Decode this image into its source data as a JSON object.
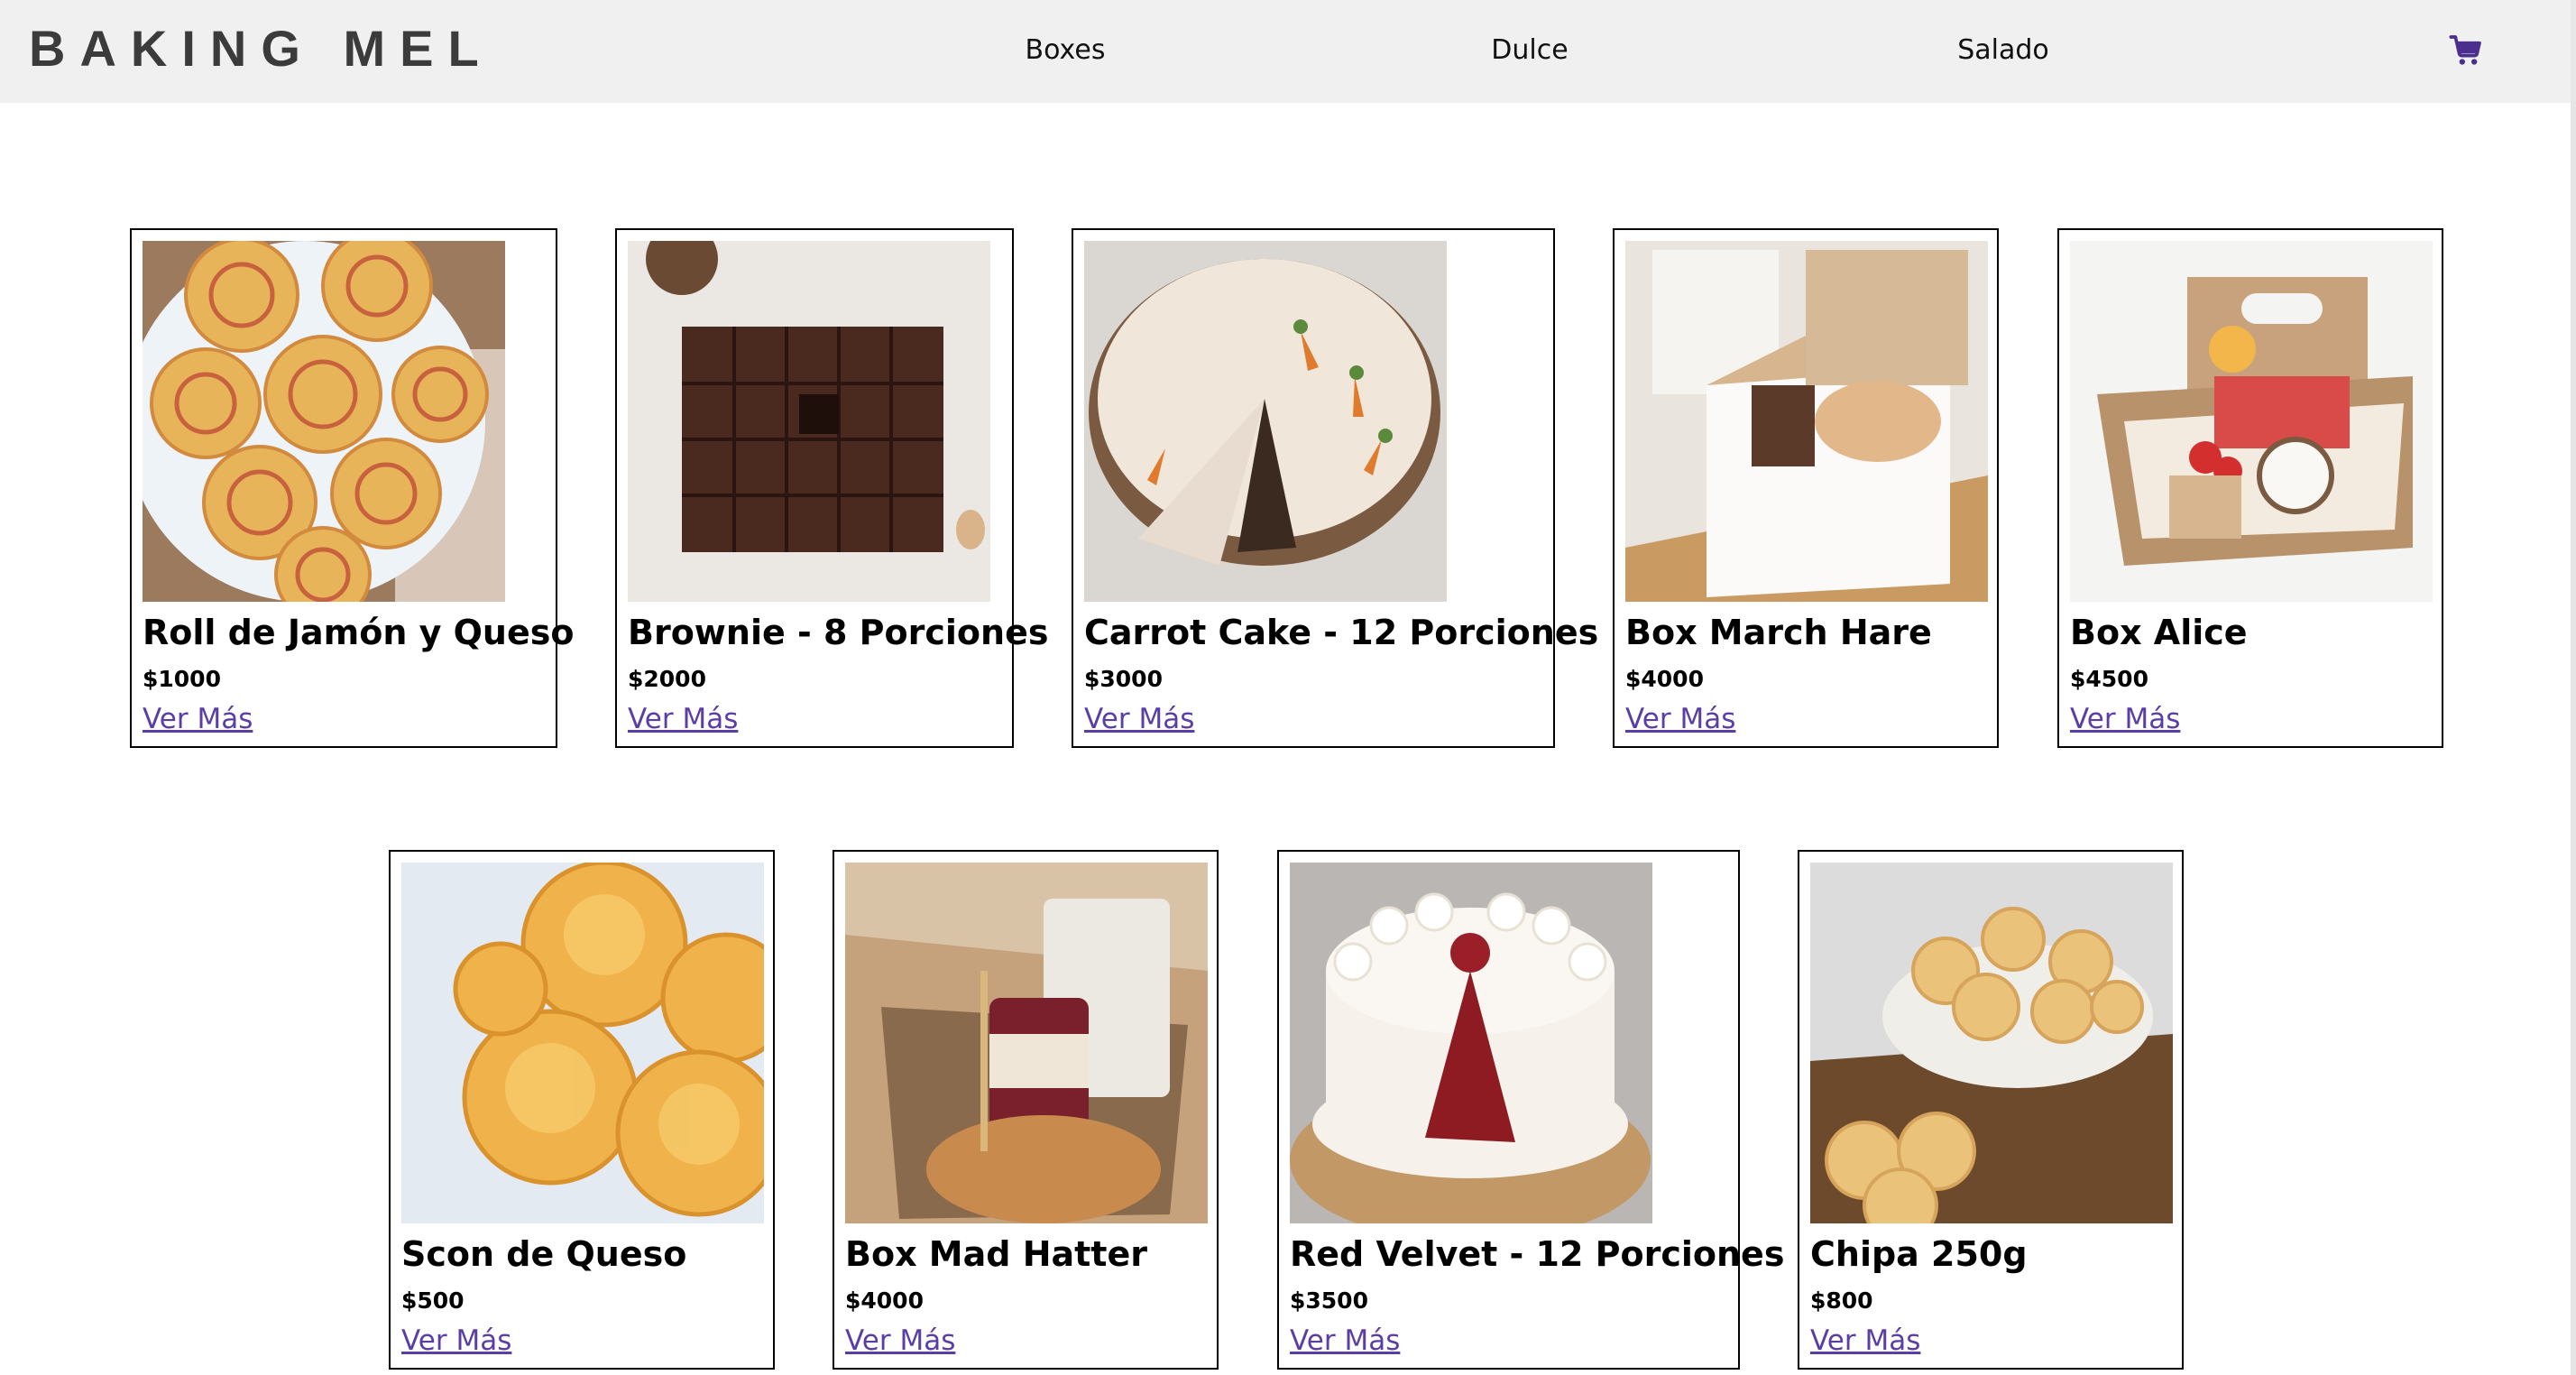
{
  "header": {
    "brand": "BAKING MEL",
    "nav": [
      "Boxes",
      "Dulce",
      "Salado"
    ]
  },
  "colors": {
    "navbar_bg": "#f0f0f0",
    "link": "#5a3ea6",
    "cart_icon": "#4a2f8f"
  },
  "icons": {
    "cart": "shopping-cart-icon"
  },
  "products": [
    {
      "name": "Roll de Jamón y Queso",
      "price": "$1000",
      "link": "Ver Más",
      "image": "ham-cheese-pinwheels-photo"
    },
    {
      "name": "Brownie - 8 Porciones",
      "price": "$2000",
      "link": "Ver Más",
      "image": "brownie-squares-photo"
    },
    {
      "name": "Carrot Cake - 12 Porciones",
      "price": "$3000",
      "link": "Ver Más",
      "image": "carrot-cake-photo"
    },
    {
      "name": "Box March Hare",
      "price": "$4000",
      "link": "Ver Más",
      "image": "gift-box-photo"
    },
    {
      "name": "Box Alice",
      "price": "$4500",
      "link": "Ver Más",
      "image": "gift-box-with-strawberries-photo"
    },
    {
      "name": "Scon de Queso",
      "price": "$500",
      "link": "Ver Más",
      "image": "cheese-scones-photo"
    },
    {
      "name": "Box Mad Hatter",
      "price": "$4000",
      "link": "Ver Más",
      "image": "coffee-gift-box-photo"
    },
    {
      "name": "Red Velvet - 12 Porciones",
      "price": "$3500",
      "link": "Ver Más",
      "image": "red-velvet-cake-photo"
    },
    {
      "name": "Chipa 250g",
      "price": "$800",
      "link": "Ver Más",
      "image": "chipa-bread-photo"
    }
  ]
}
